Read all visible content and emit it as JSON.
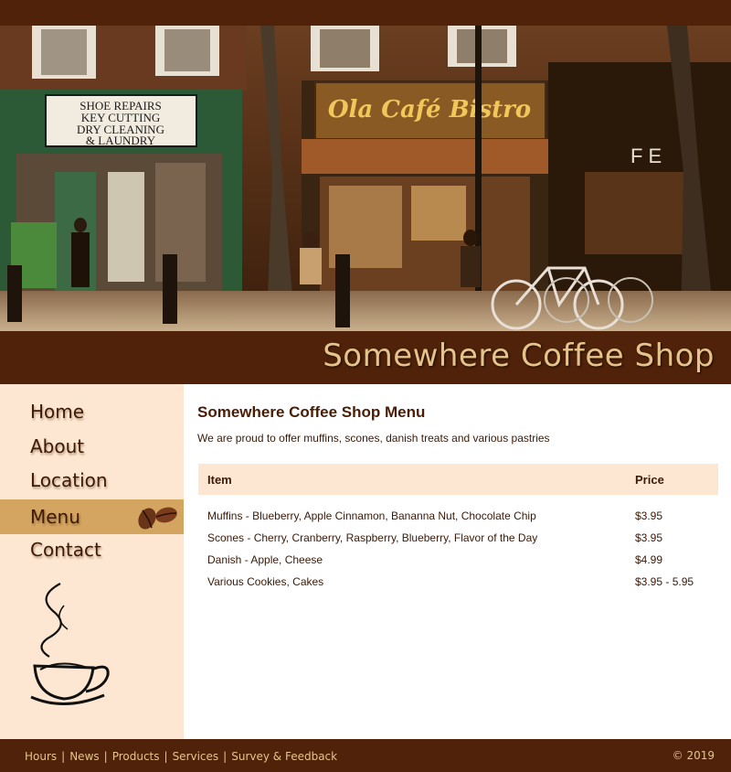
{
  "header": {
    "site_title": "Somewhere Coffee Shop"
  },
  "hero": {
    "shop_sign": "SHOE REPAIRS KEY CUTTING DRY CLEANING & LAUNDRY",
    "cafe_sign": "Ola Café Bistro"
  },
  "sidebar": {
    "items": [
      {
        "label": "Home"
      },
      {
        "label": "About"
      },
      {
        "label": "Location"
      },
      {
        "label": "Menu",
        "active": true
      },
      {
        "label": "Contact"
      }
    ]
  },
  "main": {
    "title": "Somewhere Coffee Shop Menu",
    "intro": "We are proud to offer muffins, scones, danish treats and various pastries",
    "columns": [
      "Item",
      "Price"
    ],
    "rows": [
      {
        "item": "Muffins - Blueberry, Apple Cinnamon, Bananna Nut, Chocolate Chip",
        "price": "$3.95"
      },
      {
        "item": "Scones - Cherry, Cranberry, Raspberry, Blueberry, Flavor of the Day",
        "price": "$3.95"
      },
      {
        "item": "Danish - Apple, Cheese",
        "price": "$4.99"
      },
      {
        "item": "Various Cookies, Cakes",
        "price": "$3.95 - 5.95"
      }
    ]
  },
  "footer": {
    "links": [
      "Hours",
      "News",
      "Products",
      "Services",
      "Survey & Feedback"
    ],
    "separator": "|",
    "copyright": "© 2019"
  },
  "colors": {
    "brown_dark": "#4f2209",
    "cream": "#fde7d2",
    "gold": "#e5c48c",
    "active_tan": "#d3a560"
  }
}
